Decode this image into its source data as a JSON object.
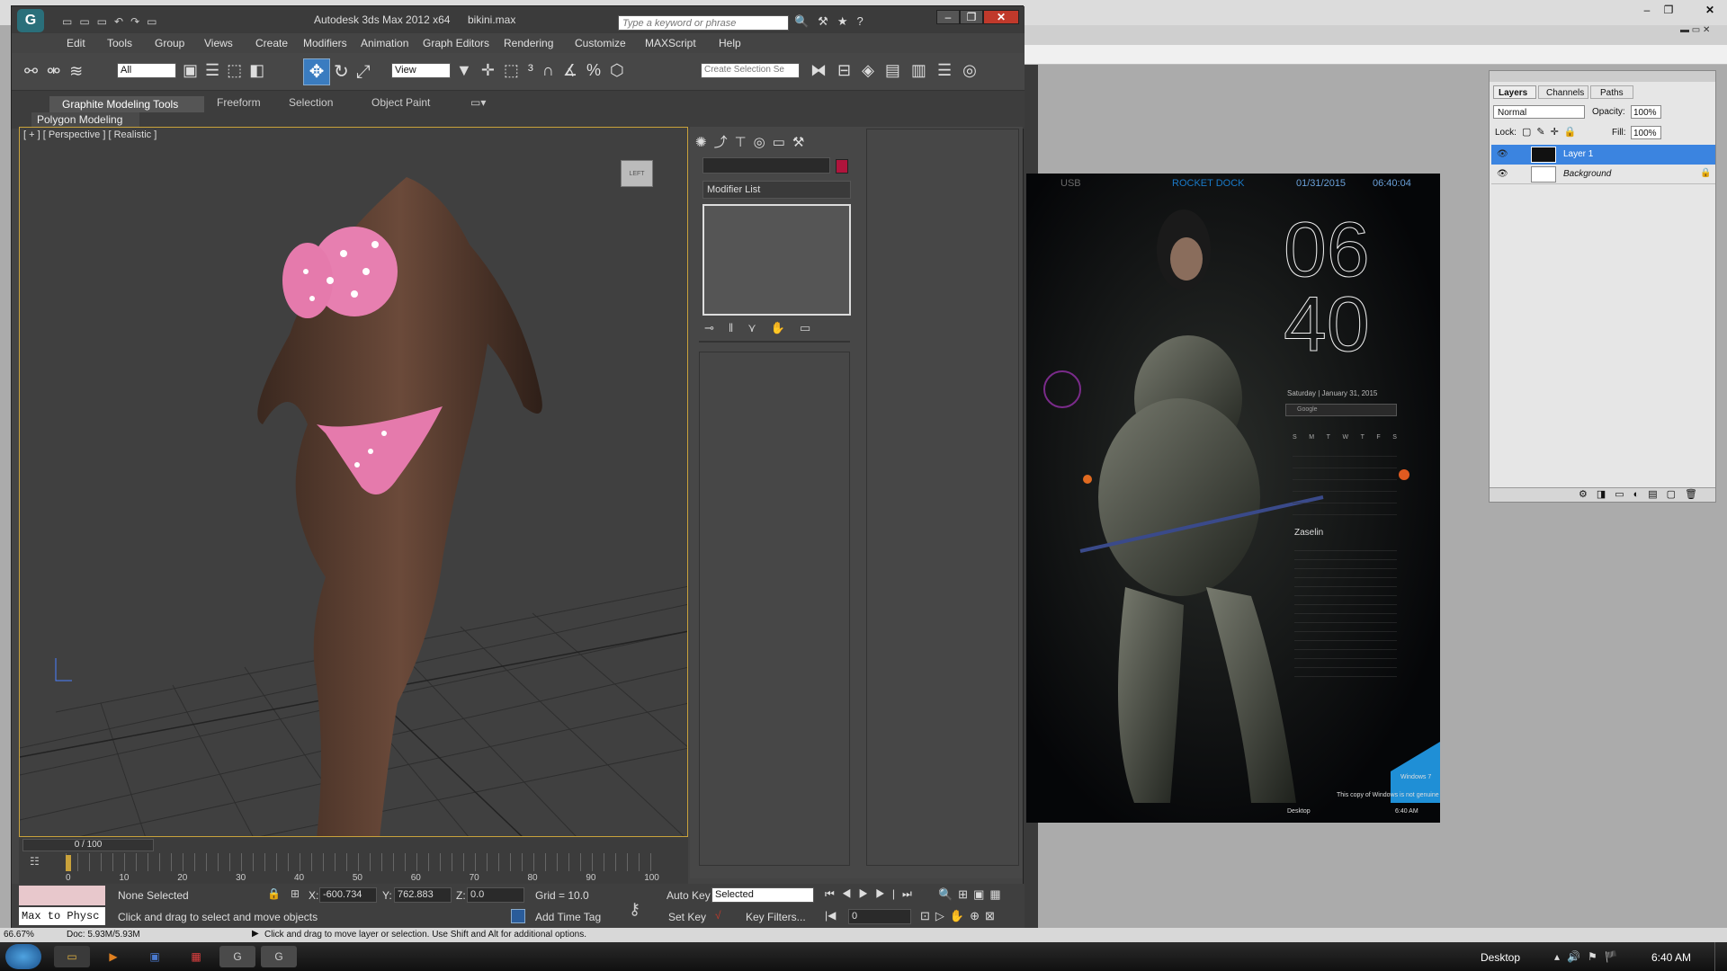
{
  "photoshop": {
    "layers_panel": {
      "tabs": [
        "Layers",
        "Channels",
        "Paths"
      ],
      "blend_mode": "Normal",
      "opacity_label": "Opacity:",
      "opacity_value": "100%",
      "lock_label": "Lock:",
      "fill_label": "Fill:",
      "fill_value": "100%",
      "layers": [
        {
          "name": "Layer 1",
          "selected": true
        },
        {
          "name": "Background",
          "selected": false
        }
      ]
    },
    "status_zoom": "66.67%",
    "status_doc": "Doc: 5.93M/5.93M",
    "status_hint": "Click and drag to move layer or selection. Use Shift and Alt for additional options.",
    "document": {
      "usb": "USB",
      "rocket": "ROCKET DOCK",
      "date_top": "01/31/2015",
      "time_top": "06:40:04",
      "clock_hour": "06",
      "clock_min": "40",
      "date_line": "Saturday | January 31, 2015",
      "search_placeholder": "Google",
      "calendar_days": [
        "S",
        "M",
        "T",
        "W",
        "T",
        "F",
        "S"
      ],
      "user": "Zaselin",
      "watermark_title": "Windows 7",
      "watermark_sub": "This copy of Windows is not genuine",
      "inner_desktop": "Desktop",
      "inner_time": "6:40 AM"
    }
  },
  "max": {
    "title": "Autodesk 3ds Max  2012 x64",
    "file": "bikini.max",
    "search_placeholder": "Type a keyword or phrase",
    "menus": [
      "Edit",
      "Tools",
      "Group",
      "Views",
      "Create",
      "Modifiers",
      "Animation",
      "Graph Editors",
      "Rendering",
      "Customize",
      "MAXScript",
      "Help"
    ],
    "selection_filter": "All",
    "ref_coord": "View",
    "selection_set_placeholder": "Create Selection Se",
    "ribbon_tabs": [
      "Graphite Modeling Tools",
      "Freeform",
      "Selection",
      "Object Paint"
    ],
    "ribbon_panel": "Polygon Modeling",
    "viewport_label": "[ + ] [ Perspective ] [ Realistic ]",
    "viewcube_face": "LEFT",
    "modifier_list": "Modifier List",
    "accent_color": "#c9a23b",
    "object_color": "#b0143c",
    "frame_counter": "0 / 100",
    "timeline_ticks": [
      "0",
      "10",
      "20",
      "30",
      "40",
      "50",
      "60",
      "70",
      "80",
      "90",
      "100"
    ],
    "status": {
      "listener": "Max to Physc",
      "selection": "None Selected",
      "x_label": "X:",
      "x_value": "-600.734",
      "y_label": "Y:",
      "y_value": "762.883",
      "z_label": "Z:",
      "z_value": "0.0",
      "grid": "Grid = 10.0",
      "prompt": "Click and drag to select and move objects",
      "add_time_tag": "Add Time Tag",
      "auto_key": "Auto Key",
      "set_key": "Set Key",
      "key_mode": "Selected",
      "key_filters": "Key Filters...",
      "frame": "0"
    }
  },
  "taskbar": {
    "desktop_label": "Desktop",
    "clock": "6:40 AM"
  }
}
